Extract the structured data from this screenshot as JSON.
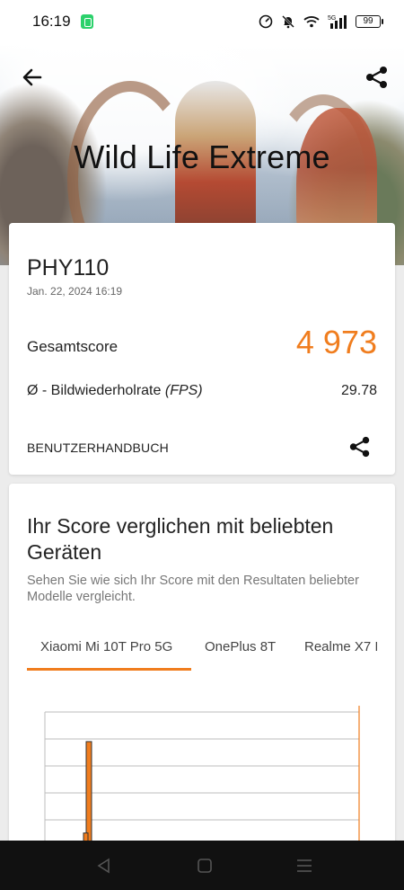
{
  "status_bar": {
    "time": "16:19",
    "network": "5G",
    "battery": "99"
  },
  "header": {
    "title": "Wild Life Extreme",
    "back_icon": "arrow-left-icon",
    "share_icon": "share-icon"
  },
  "result": {
    "device": "PHY110",
    "date": "Jan. 22, 2024 16:19",
    "score_label": "Gesamtscore",
    "score_value": "4 973",
    "fps_label_prefix": "Ø - Bildwiederholrate",
    "fps_label_unit": "(FPS)",
    "fps_value": "29.78",
    "manual_link": "BENUTZERHANDBUCH"
  },
  "compare": {
    "title": "Ihr Score verglichen mit beliebten Geräten",
    "description": "Sehen Sie wie sich Ihr Score mit den Resultaten beliebter Modelle vergleicht.",
    "tabs": [
      {
        "label": "Xiaomi Mi 10T Pro 5G",
        "active": true
      },
      {
        "label": "OnePlus 8T",
        "active": false
      },
      {
        "label": "Realme X7 I",
        "active": false
      }
    ]
  },
  "colors": {
    "accent": "#f07d1e",
    "text": "#222222",
    "muted": "#777777"
  },
  "chart_data": {
    "type": "bar",
    "note_visible_portion_only": true,
    "grid": true,
    "series": [
      {
        "values": [
          0.72,
          0.17
        ]
      }
    ],
    "marker_line": true
  }
}
